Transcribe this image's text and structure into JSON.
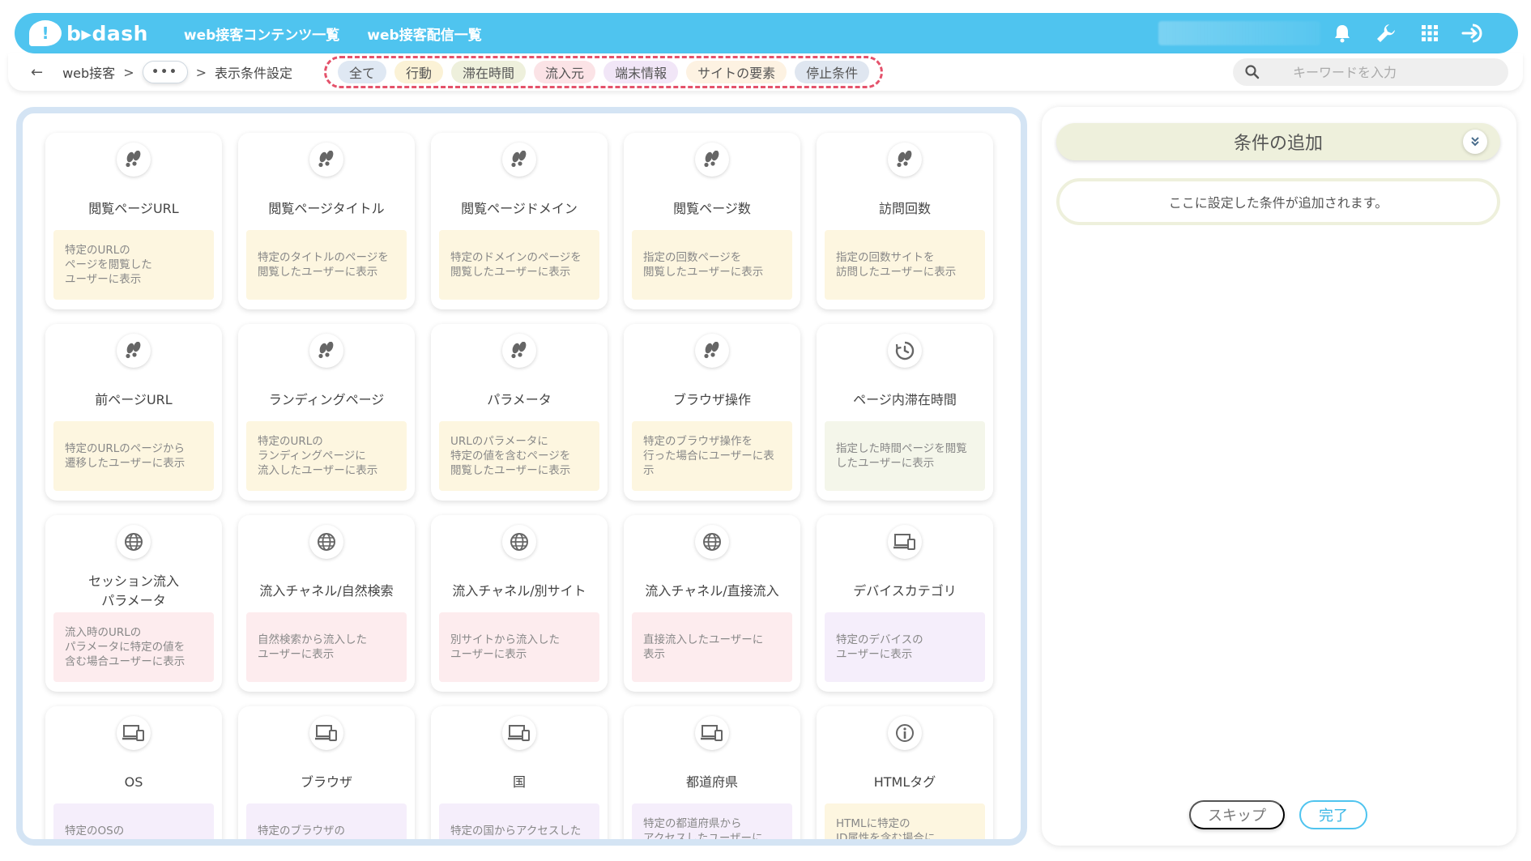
{
  "header": {
    "logo_text": "b▸dash",
    "nav": [
      "web接客コンテンツ一覧",
      "web接客配信一覧"
    ]
  },
  "subbar": {
    "breadcrumb": [
      "web接客",
      "表示条件設定"
    ],
    "more_label": "•••",
    "chips": [
      {
        "label": "全て",
        "color": "#dfe8f3"
      },
      {
        "label": "行動",
        "color": "#fbf2d6"
      },
      {
        "label": "滞在時間",
        "color": "#eef0dc"
      },
      {
        "label": "流入元",
        "color": "#fbe3e6"
      },
      {
        "label": "端末情報",
        "color": "#f1e6f7"
      },
      {
        "label": "サイトの要素",
        "color": "#fdf2e2"
      },
      {
        "label": "停止条件",
        "color": "#dfe6f0"
      }
    ],
    "search_placeholder": "キーワードを入力"
  },
  "cards": [
    {
      "title": "閲覧ページURL",
      "desc": "特定のURLの\nページを閲覧した\nユーザーに表示",
      "icon": "footprints-icon",
      "tone": "yellow"
    },
    {
      "title": "閲覧ページタイトル",
      "desc": "特定のタイトルのページを\n閲覧したユーザーに表示",
      "icon": "footprints-icon",
      "tone": "yellow"
    },
    {
      "title": "閲覧ページドメイン",
      "desc": "特定のドメインのページを\n閲覧したユーザーに表示",
      "icon": "footprints-icon",
      "tone": "yellow"
    },
    {
      "title": "閲覧ページ数",
      "desc": "指定の回数ページを\n閲覧したユーザーに表示",
      "icon": "footprints-icon",
      "tone": "yellow"
    },
    {
      "title": "訪問回数",
      "desc": "指定の回数サイトを\n訪問したユーザーに表示",
      "icon": "footprints-icon",
      "tone": "yellow"
    },
    {
      "title": "前ページURL",
      "desc": "特定のURLのページから\n遷移したユーザーに表示",
      "icon": "footprints-icon",
      "tone": "yellow"
    },
    {
      "title": "ランディングページ",
      "desc": "特定のURLの\nランディングページに\n流入したユーザーに表示",
      "icon": "footprints-icon",
      "tone": "yellow"
    },
    {
      "title": "パラメータ",
      "desc": "URLのパラメータに\n特定の値を含むページを\n閲覧したユーザーに表示",
      "icon": "footprints-icon",
      "tone": "yellow"
    },
    {
      "title": "ブラウザ操作",
      "desc": "特定のブラウザ操作を\n行った場合にユーザーに表示",
      "icon": "footprints-icon",
      "tone": "yellow"
    },
    {
      "title": "ページ内滞在時間",
      "desc": "指定した時間ページを閲覧\nしたユーザーに表示",
      "icon": "clock-icon",
      "tone": "mint"
    },
    {
      "title": "セッション流入\nパラメータ",
      "desc": "流入時のURLの\nパラメータに特定の値を\n含む場合ユーザーに表示",
      "icon": "globe-icon",
      "tone": "pink"
    },
    {
      "title": "流入チャネル/自然検索",
      "desc": "自然検索から流入した\nユーザーに表示",
      "icon": "globe-icon",
      "tone": "pink"
    },
    {
      "title": "流入チャネル/別サイト",
      "desc": "別サイトから流入した\nユーザーに表示",
      "icon": "globe-icon",
      "tone": "pink"
    },
    {
      "title": "流入チャネル/直接流入",
      "desc": "直接流入したユーザーに\n表示",
      "icon": "globe-icon",
      "tone": "pink"
    },
    {
      "title": "デバイスカテゴリ",
      "desc": "特定のデバイスの\nユーザーに表示",
      "icon": "laptop-icon",
      "tone": "lavender"
    },
    {
      "title": "OS",
      "desc": "特定のOSの\nユーザーに表示",
      "icon": "laptop-icon",
      "tone": "lavender"
    },
    {
      "title": "ブラウザ",
      "desc": "特定のブラウザの\nユーザーに表示",
      "icon": "laptop-icon",
      "tone": "lavender"
    },
    {
      "title": "国",
      "desc": "特定の国からアクセスした\nユーザーに表示",
      "icon": "laptop-icon",
      "tone": "lavender"
    },
    {
      "title": "都道府県",
      "desc": "特定の都道府県から\nアクセスしたユーザーに\n表示",
      "icon": "laptop-icon",
      "tone": "lavender"
    },
    {
      "title": "HTMLタグ",
      "desc": "HTMLに特定の\nID属性を含む場合に\nユーザーに表示",
      "icon": "info-icon",
      "tone": "yellow"
    }
  ],
  "right_panel": {
    "title": "条件の追加",
    "placeholder_text": "ここに設定した条件が追加されます。",
    "skip_label": "スキップ",
    "done_label": "完了"
  },
  "colors": {
    "header_bg": "#4fc4ef",
    "panel_border": "#d4e4f4",
    "dashed_highlight": "#e4526b"
  }
}
